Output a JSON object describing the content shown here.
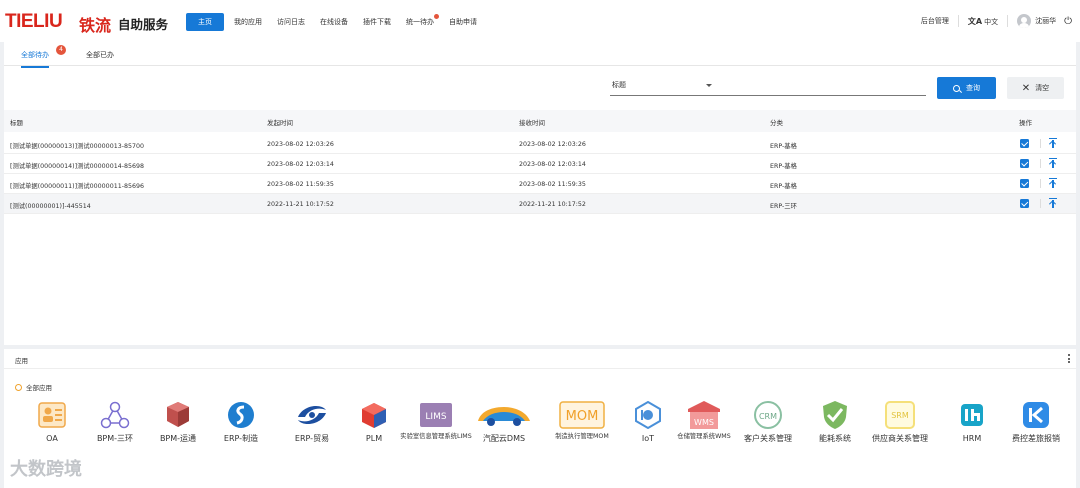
{
  "header": {
    "logo": "TIELIU",
    "logo_cn": "铁流",
    "app_name": "自助服务",
    "nav": [
      "主页",
      "我的应用",
      "访问日志",
      "在线设备",
      "插件下载",
      "统一待办",
      "自助申请"
    ],
    "admin": "后台管理",
    "lang": "中文",
    "user": "沈丽华"
  },
  "tabs": {
    "todo": "全部待办",
    "todo_badge": "4",
    "done": "全部已办"
  },
  "filter": {
    "field": "标题",
    "query_button": "查询",
    "clear_button": "清空"
  },
  "table": {
    "headers": [
      "标题",
      "发起时间",
      "接收时间",
      "分类",
      "操作"
    ],
    "rows": [
      [
        "[测试单据(00000013)]测试00000013-85700",
        "2023-08-02 12:03:26",
        "2023-08-02 12:03:26",
        "ERP-基格"
      ],
      [
        "[测试单据(00000014)]测试00000014-85698",
        "2023-08-02 12:03:14",
        "2023-08-02 12:03:14",
        "ERP-基格"
      ],
      [
        "[测试单据(00000011)]测试00000011-85696",
        "2023-08-02 11:59:35",
        "2023-08-02 11:59:35",
        "ERP-基格"
      ],
      [
        "[测试(00000001)]-445514",
        "2022-11-21 10:17:52",
        "2022-11-21 10:17:52",
        "ERP-三环"
      ]
    ]
  },
  "apps": {
    "title": "应用",
    "all": "全部应用",
    "items": [
      {
        "label": "OA",
        "icon": "oa-icon"
      },
      {
        "label": "BPM-三环",
        "icon": "bpm-network-icon"
      },
      {
        "label": "BPM-运通",
        "icon": "bpm-cubes-icon"
      },
      {
        "label": "ERP-制造",
        "icon": "erp-s-icon"
      },
      {
        "label": "ERP-贸易",
        "icon": "erp-trade-icon"
      },
      {
        "label": "PLM",
        "icon": "plm-cube-icon"
      },
      {
        "label": "实验室信息管理系统LIMS",
        "icon": "lims-icon",
        "icon_text": "LIMS"
      },
      {
        "label": "汽配云DMS",
        "icon": "car-icon"
      },
      {
        "label": "制造执行管理MOM",
        "icon": "mom-icon",
        "icon_text": "MOM"
      },
      {
        "label": "IoT",
        "icon": "iot-icon"
      },
      {
        "label": "仓储管理系统WMS",
        "icon": "wms-icon",
        "icon_text": "WMS"
      },
      {
        "label": "客户关系管理",
        "icon": "crm-icon",
        "icon_text": "CRM"
      },
      {
        "label": "能耗系统",
        "icon": "energy-shield-icon"
      },
      {
        "label": "供应商关系管理",
        "icon": "srm-icon",
        "icon_text": "SRM"
      },
      {
        "label": "HRM",
        "icon": "hrm-icon"
      },
      {
        "label": "费控差旅报销",
        "icon": "expense-icon"
      }
    ]
  },
  "watermark": "大数跨境",
  "colors": {
    "primary": "#1679d7",
    "brand_red": "#d9261c",
    "badge": "#e4553c"
  }
}
